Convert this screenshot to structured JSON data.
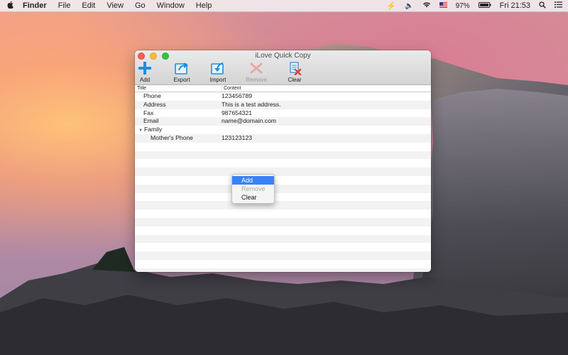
{
  "menubar": {
    "apple_icon": "apple-icon",
    "app_name": "Finder",
    "items": [
      "File",
      "Edit",
      "View",
      "Go",
      "Window",
      "Help"
    ],
    "status": {
      "battery": "97%",
      "clock": "Fri 21:53"
    }
  },
  "window": {
    "title": "iLove Quick Copy",
    "toolbar": [
      {
        "label": "Add",
        "icon": "plus-icon",
        "enabled": true
      },
      {
        "label": "Export",
        "icon": "export-icon",
        "enabled": true
      },
      {
        "label": "Import",
        "icon": "import-icon",
        "enabled": true
      },
      {
        "label": "Remove",
        "icon": "remove-icon",
        "enabled": false
      },
      {
        "label": "Clear",
        "icon": "clear-icon",
        "enabled": true
      }
    ],
    "table": {
      "headers": [
        "Title",
        "Content"
      ],
      "rows": [
        {
          "title": "Phone",
          "content": "123456789"
        },
        {
          "title": "Address",
          "content": "This is a test address."
        },
        {
          "title": "Fax",
          "content": "987654321"
        },
        {
          "title": "Email",
          "content": "name@domain.com"
        },
        {
          "title": "Family",
          "content": "",
          "group": true,
          "expanded": true
        },
        {
          "title": "Mother's Phone",
          "content": "123123123",
          "child": true
        }
      ]
    }
  },
  "context_menu": {
    "items": [
      {
        "label": "Add",
        "selected": true
      },
      {
        "label": "Remove",
        "disabled": true
      },
      {
        "label": "Clear"
      }
    ]
  },
  "colors": {
    "accent": "#3a82f7",
    "toolbar_icon_blue": "#1a8fe0",
    "remove_red": "#e04040"
  }
}
